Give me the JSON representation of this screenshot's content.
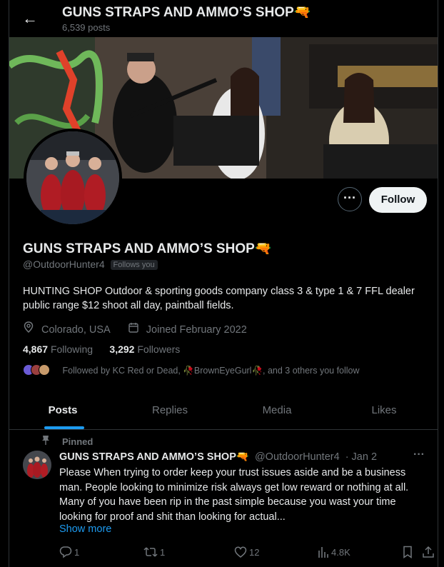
{
  "header": {
    "back_label": "←",
    "title": "GUNS STRAPS AND AMMO’S SHOP",
    "title_emoji": "🔫",
    "posts_count": "6,539 posts"
  },
  "profile": {
    "name": "GUNS STRAPS AND AMMO’S SHOP",
    "name_emoji": "🔫",
    "handle": "@OutdoorHunter4",
    "follows_you": "Follows you",
    "bio": "HUNTING SHOP Outdoor & sporting goods company class 3 & type 1 & 7 FFL dealer public range $12 shoot all day, paintball fields.",
    "location": "Colorado, USA",
    "joined": "Joined February 2022",
    "following_count": "4,867",
    "following_label": "Following",
    "followers_count": "3,292",
    "followers_label": "Followers",
    "followed_by": "Followed by KC Red or Dead, 🥀BrownEyeGurl🥀, and 3 others you follow"
  },
  "actions": {
    "more_label": "···",
    "follow_label": "Follow"
  },
  "tabs": [
    {
      "label": "Posts",
      "active": true
    },
    {
      "label": "Replies",
      "active": false
    },
    {
      "label": "Media",
      "active": false
    },
    {
      "label": "Likes",
      "active": false
    }
  ],
  "post": {
    "pinned_label": "Pinned",
    "author_name": "GUNS STRAPS AND AMMO’S SHOP",
    "author_emoji": "🔫",
    "author_handle": "@OutdoorHunter4",
    "date": "· Jan 2",
    "more_label": "···",
    "text": "Please When trying to order keep your trust issues aside and be a business man. People looking to minimize risk always get low reward or nothing at all. Many of you have been rip in the past simple because you wast your time looking for proof and shit  than looking for actual...",
    "show_more": "Show more",
    "replies": "1",
    "reposts": "1",
    "likes": "12",
    "views": "4.8K"
  },
  "colors": {
    "background": "#000000",
    "text": "#e7e9ea",
    "muted": "#71767b",
    "accent": "#1d9bf0",
    "border": "#2f3336"
  }
}
